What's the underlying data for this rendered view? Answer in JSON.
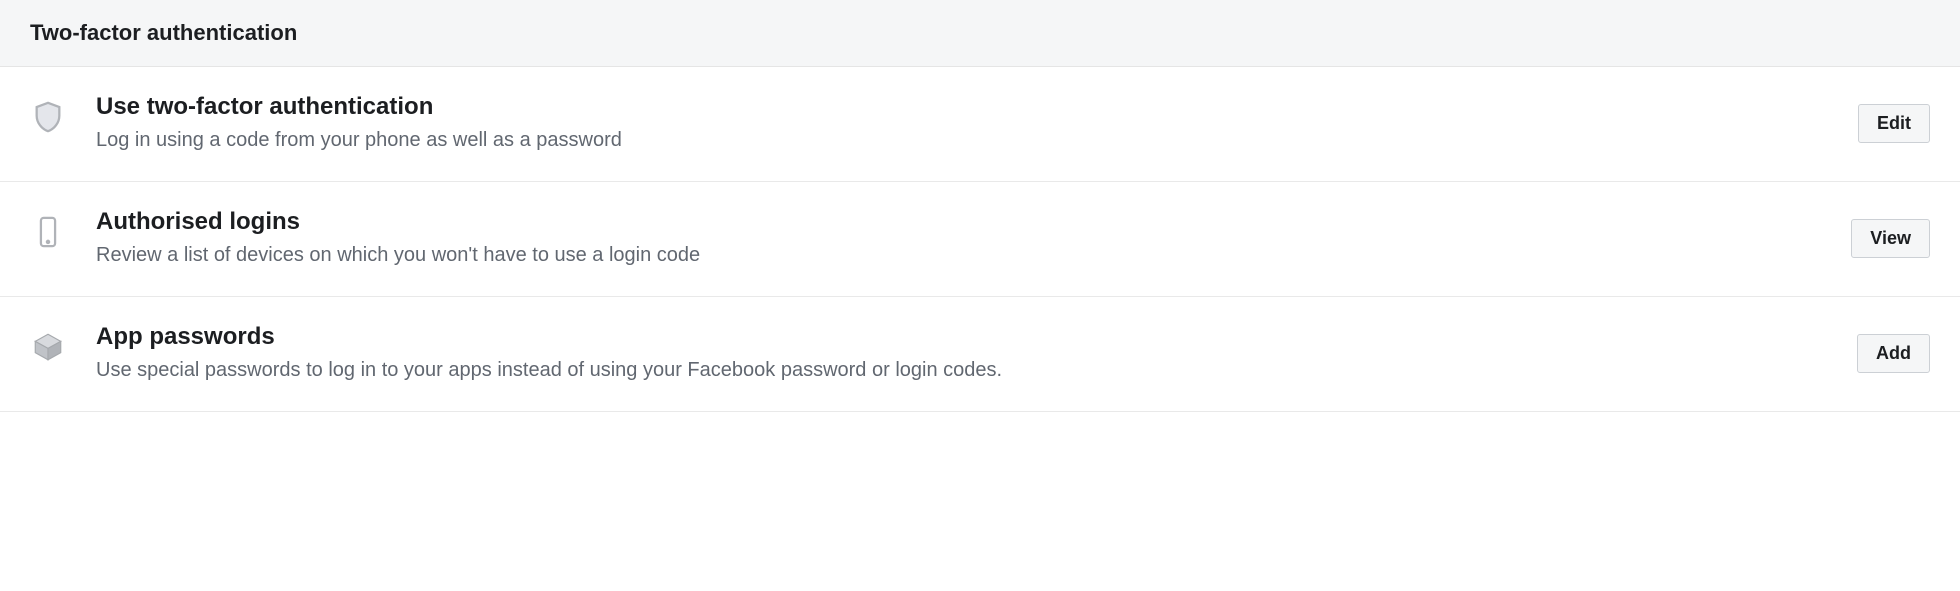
{
  "section": {
    "title": "Two-factor authentication",
    "items": [
      {
        "title": "Use two-factor authentication",
        "description": "Log in using a code from your phone as well as a password",
        "action_label": "Edit"
      },
      {
        "title": "Authorised logins",
        "description": "Review a list of devices on which you won't have to use a login code",
        "action_label": "View"
      },
      {
        "title": "App passwords",
        "description": "Use special passwords to log in to your apps instead of using your Facebook password or login codes.",
        "action_label": "Add"
      }
    ]
  }
}
